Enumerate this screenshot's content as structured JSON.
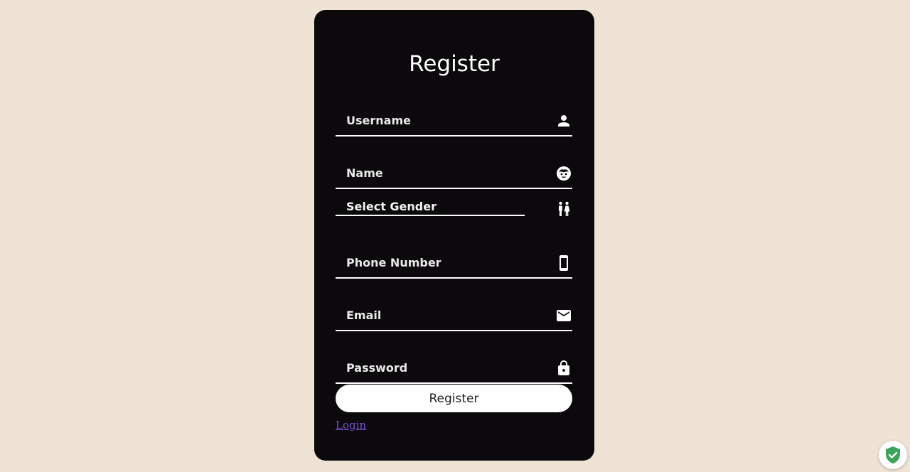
{
  "page": {
    "background_color": "#efe3d6",
    "card_color": "#0b090b",
    "link_color": "#7a4fd6",
    "badge_color": "#3aa55a"
  },
  "form": {
    "title": "Register",
    "fields": [
      {
        "placeholder": "Username",
        "icon": "person-icon"
      },
      {
        "placeholder": "Name",
        "icon": "face-icon"
      },
      {
        "placeholder": "Phone Number",
        "icon": "smartphone-icon"
      },
      {
        "placeholder": "Email",
        "icon": "mail-icon"
      },
      {
        "placeholder": "Password",
        "icon": "lock-icon"
      }
    ],
    "gender_select": {
      "value": "Select Gender",
      "icon": "people-icon"
    },
    "submit_label": "Register",
    "login_link_label": "Login"
  },
  "browser_extension": {
    "icon": "shield-check-icon"
  }
}
